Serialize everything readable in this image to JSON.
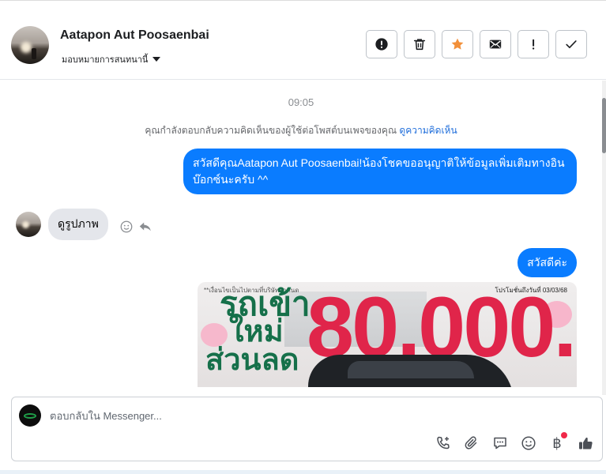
{
  "header": {
    "contact_name": "Aatapon Aut Poosaenbai",
    "assign_label": "มอบหมายการสนทนานี้",
    "actions": [
      {
        "name": "spam-button",
        "icon": "alert-circle-icon"
      },
      {
        "name": "delete-button",
        "icon": "trash-icon"
      },
      {
        "name": "star-button",
        "icon": "star-icon"
      },
      {
        "name": "mark-unread-button",
        "icon": "envelope-icon"
      },
      {
        "name": "follow-up-button",
        "icon": "exclamation-icon"
      },
      {
        "name": "done-button",
        "icon": "check-icon"
      }
    ],
    "accent_star": "#f2903a"
  },
  "conversation": {
    "timestamp": "09:05",
    "notice_text": "คุณกำลังตอบกลับความคิดเห็นของผู้ใช้ต่อโพสต์บนเพจของคุณ",
    "notice_link": "ดูความคิดเห็น",
    "messages": [
      {
        "from": "page",
        "text": "สวัสดีคุณAatapon Aut Poosaenbai!น้องโชคขออนุญาติให้ข้อมูลเพิ่มเติมทางอินบ๊อกซ์นะครับ ^^"
      },
      {
        "from": "user",
        "text": "ดูรูปภาพ"
      },
      {
        "from": "page",
        "text": "สวัสดีค่ะ"
      }
    ],
    "promo_image": {
      "top_left_text": "**เงื่อนไขเป็นไปตามที่บริษัทกำหนด",
      "top_right_text": "โปรโมชั่นถึงวันที่ 03/03/68",
      "line1": "รถเข้า",
      "line2": "ใหม่",
      "line3": "ส่วนลด",
      "amount": "80,000.-"
    },
    "bubble_color": "#0a7cff"
  },
  "composer": {
    "placeholder": "ตอบกลับใน Messenger...",
    "tools": [
      "call-add-icon",
      "paperclip-icon",
      "saved-reply-icon",
      "emoji-icon",
      "baht-icon",
      "like-icon"
    ],
    "baht_symbol": "฿"
  }
}
